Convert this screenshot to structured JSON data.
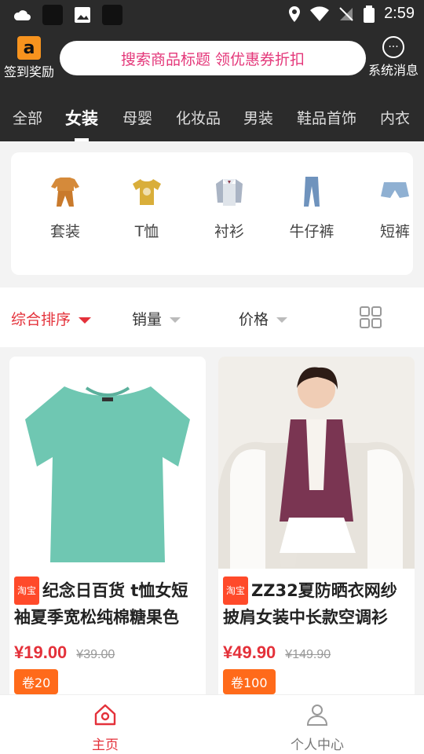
{
  "statusbar": {
    "time": "2:59"
  },
  "header": {
    "sign_label": "签到奖励",
    "search_placeholder": "搜索商品标题 领优惠券折扣",
    "msg_label": "系统消息",
    "accent": "#e4387a"
  },
  "tabs": [
    "全部",
    "女装",
    "母婴",
    "化妆品",
    "男装",
    "鞋品首饰",
    "内衣"
  ],
  "categories": [
    "套装",
    "T恤",
    "衬衫",
    "牛仔裤",
    "短裤"
  ],
  "sort": {
    "comprehensive": "综合排序",
    "sales": "销量",
    "price": "价格"
  },
  "products": [
    {
      "platform": "淘宝",
      "title": "纪念日百货 t恤女短袖夏季宽松纯棉糖果色",
      "price": "¥19.00",
      "original_price": "¥39.00",
      "coupon": "卷20"
    },
    {
      "platform": "淘宝",
      "title": "ZZ32夏防晒衣网纱披肩女装中长款空调衫",
      "price": "¥49.90",
      "original_price": "¥149.90",
      "coupon": "卷100"
    }
  ],
  "bottom_nav": {
    "home": "主页",
    "profile": "个人中心"
  },
  "colors": {
    "red": "#e4313a",
    "orange": "#ff6a1a",
    "dark": "#2b2b2b"
  }
}
